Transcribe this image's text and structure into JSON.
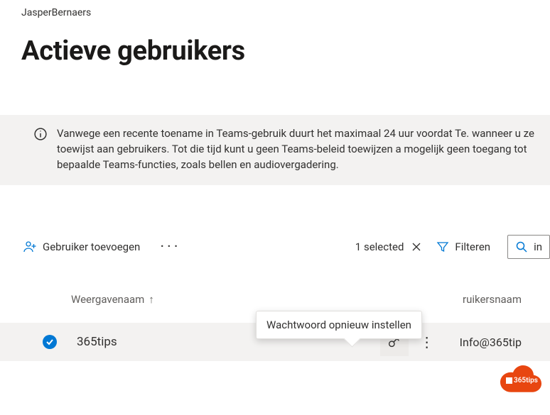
{
  "tenant": "JasperBernaers",
  "page_title": "Actieve gebruikers",
  "banner": {
    "text": "Vanwege een recente toename in Teams-gebruik duurt het maximaal 24 uur voordat Te. wanneer u ze toewijst aan gebruikers. Tot die tijd kunt u geen Teams-beleid toewijzen a mogelijk geen toegang tot bepaalde Teams-functies, zoals bellen en audiovergadering."
  },
  "toolbar": {
    "add_user": "Gebruiker toevoegen",
    "selected": "1 selected",
    "filter": "Filteren",
    "search_value": "in"
  },
  "columns": {
    "display_name": "Weergavenaam",
    "sort_arrow": "↑",
    "username": "ruikersnaam"
  },
  "tooltip": "Wachtwoord opnieuw instellen",
  "row": {
    "display_name": "365tips",
    "username": "Info@365tip"
  },
  "watermark": "365tips"
}
